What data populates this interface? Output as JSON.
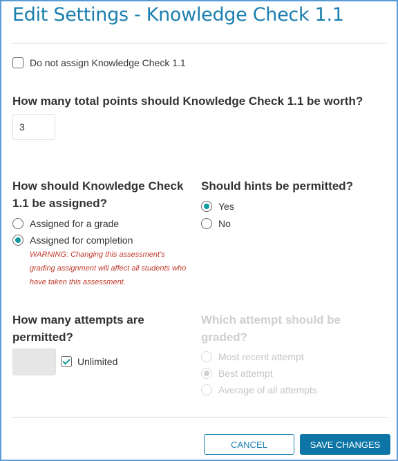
{
  "title": "Edit Settings - Knowledge Check 1.1",
  "do_not_assign": {
    "label": "Do not assign Knowledge Check 1.1",
    "checked": false
  },
  "points": {
    "question": "How many total points should Knowledge Check 1.1 be worth?",
    "value": "3"
  },
  "assignment": {
    "question_line1": "How should Knowledge Check",
    "question_line2": "1.1 be assigned?",
    "options": [
      {
        "label": "Assigned for a grade",
        "selected": false
      },
      {
        "label": "Assigned for completion",
        "selected": true
      }
    ],
    "warning_line1": "WARNING: Changing this assessment's",
    "warning_line2": "grading assignment will affect all students who",
    "warning_line3": "have taken this assessment."
  },
  "hints": {
    "question": "Should hints be permitted?",
    "options": [
      {
        "label": "Yes",
        "selected": true
      },
      {
        "label": "No",
        "selected": false
      }
    ]
  },
  "attempts": {
    "question_line1": "How many attempts are",
    "question_line2": "permitted?",
    "value": "",
    "unlimited_label": "Unlimited",
    "unlimited_checked": true
  },
  "graded_attempt": {
    "question_line1": "Which attempt should be",
    "question_line2": "graded?",
    "disabled": true,
    "options": [
      {
        "label": "Most recent attempt",
        "selected": false
      },
      {
        "label": "Best attempt",
        "selected": true
      },
      {
        "label": "Average of all attempts",
        "selected": false
      }
    ]
  },
  "buttons": {
    "cancel": "CANCEL",
    "save": "SAVE CHANGES"
  },
  "colors": {
    "accent": "#1a7fae",
    "radio_selected": "#139aa0",
    "warning": "#c0392b",
    "border": "#5b9bd5"
  }
}
